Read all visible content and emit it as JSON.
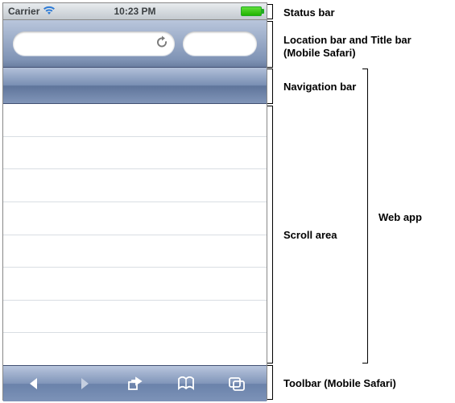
{
  "statusbar": {
    "carrier": "Carrier",
    "time": "10:23 PM"
  },
  "annotations": {
    "status_bar": "Status bar",
    "location_bar": "Location bar and Title bar\n(Mobile Safari)",
    "navigation_bar": "Navigation bar",
    "scroll_area": "Scroll area",
    "web_app": "Web app",
    "toolbar": "Toolbar (Mobile Safari)"
  }
}
